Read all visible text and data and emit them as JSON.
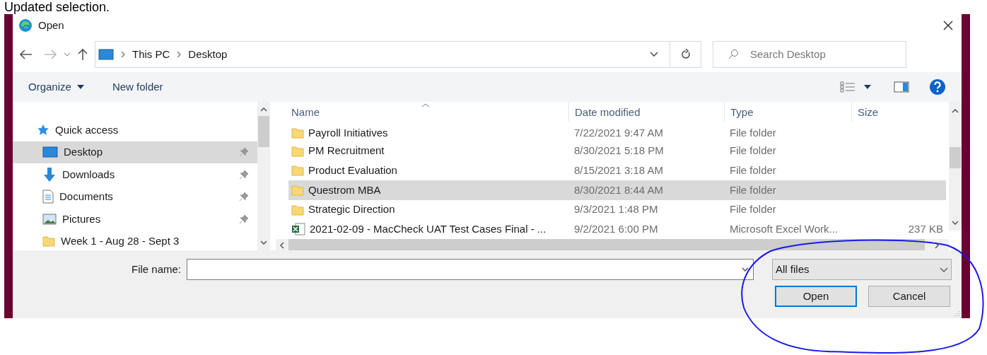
{
  "caption": "Updated selection.",
  "window": {
    "title": "Open"
  },
  "address": {
    "crumbs": [
      "This PC",
      "Desktop"
    ]
  },
  "search": {
    "placeholder": "Search Desktop"
  },
  "toolbar": [
    {
      "label": "Organize",
      "menu": true
    },
    {
      "label": "New folder",
      "menu": false
    }
  ],
  "nav": [
    {
      "label": "Quick access",
      "kind": "header",
      "selected": false,
      "pinned": false
    },
    {
      "label": "Desktop",
      "kind": "desktop",
      "selected": true,
      "pinned": true
    },
    {
      "label": "Downloads",
      "kind": "downloads",
      "selected": false,
      "pinned": true
    },
    {
      "label": "Documents",
      "kind": "documents",
      "selected": false,
      "pinned": true
    },
    {
      "label": "Pictures",
      "kind": "pictures",
      "selected": false,
      "pinned": true
    },
    {
      "label": "Week 1 - Aug 28 - Sept 3",
      "kind": "folder",
      "selected": false,
      "pinned": false
    }
  ],
  "columns": [
    "Name",
    "Date modified",
    "Type",
    "Size"
  ],
  "rows": [
    {
      "name": "Payroll Initiatives",
      "date": "7/22/2021 9:47 AM",
      "type": "File folder",
      "kind": "folder",
      "selected": false
    },
    {
      "name": "PM Recruitment",
      "date": "8/30/2021 5:18 PM",
      "type": "File folder",
      "kind": "folder",
      "selected": false
    },
    {
      "name": "Product Evaluation",
      "date": "8/15/2021 3:18 AM",
      "type": "File folder",
      "kind": "folder",
      "selected": false
    },
    {
      "name": "Questrom MBA",
      "date": "8/30/2021 8:44 AM",
      "type": "File folder",
      "kind": "folder",
      "selected": true
    },
    {
      "name": "Strategic Direction",
      "date": "9/3/2021 1:48 PM",
      "type": "File folder",
      "kind": "folder",
      "selected": false
    },
    {
      "name": "2021-02-09 - MacCheck UAT Test Cases  Final - ...",
      "date": "9/2/2021 6:00 PM",
      "type": "Microsoft Excel Work...",
      "size": "237 KB",
      "kind": "excel",
      "selected": false
    }
  ],
  "file_name": {
    "label": "File name:"
  },
  "filter": {
    "value": "All files"
  },
  "buttons": [
    {
      "label": "Open",
      "focused": true
    },
    {
      "label": "Cancel",
      "focused": false
    }
  ]
}
